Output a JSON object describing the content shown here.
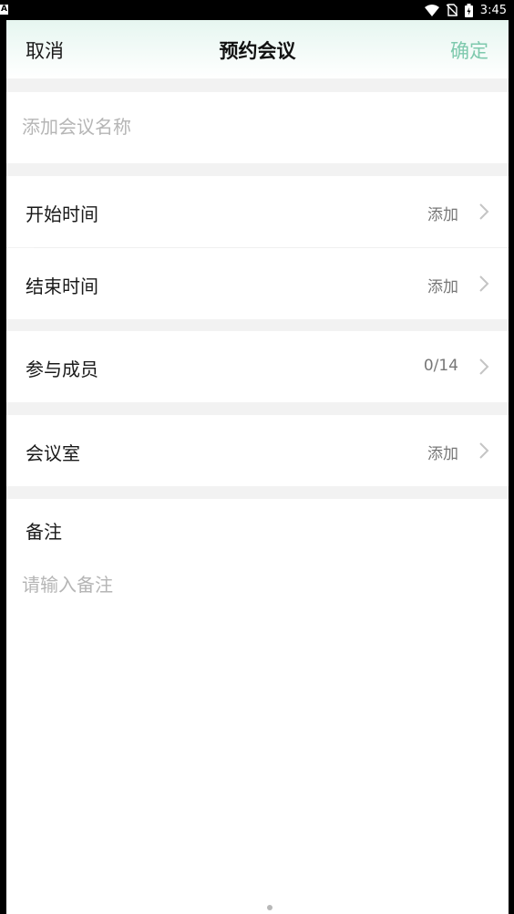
{
  "status_bar": {
    "left_indicator": "A",
    "time": "3:45",
    "icons": [
      "wifi-icon",
      "no-sim-icon",
      "battery-charging-icon"
    ]
  },
  "header": {
    "cancel_label": "取消",
    "title": "预约会议",
    "confirm_label": "确定",
    "confirm_color": "#7ec9ad"
  },
  "meeting_name": {
    "value": "",
    "placeholder": "添加会议名称"
  },
  "rows": {
    "start_time": {
      "label": "开始时间",
      "value": "添加"
    },
    "end_time": {
      "label": "结束时间",
      "value": "添加"
    },
    "members": {
      "label": "参与成员",
      "value": "0/14"
    },
    "room": {
      "label": "会议室",
      "value": "添加"
    }
  },
  "remark": {
    "label": "备注",
    "value": "",
    "placeholder": "请输入备注"
  }
}
